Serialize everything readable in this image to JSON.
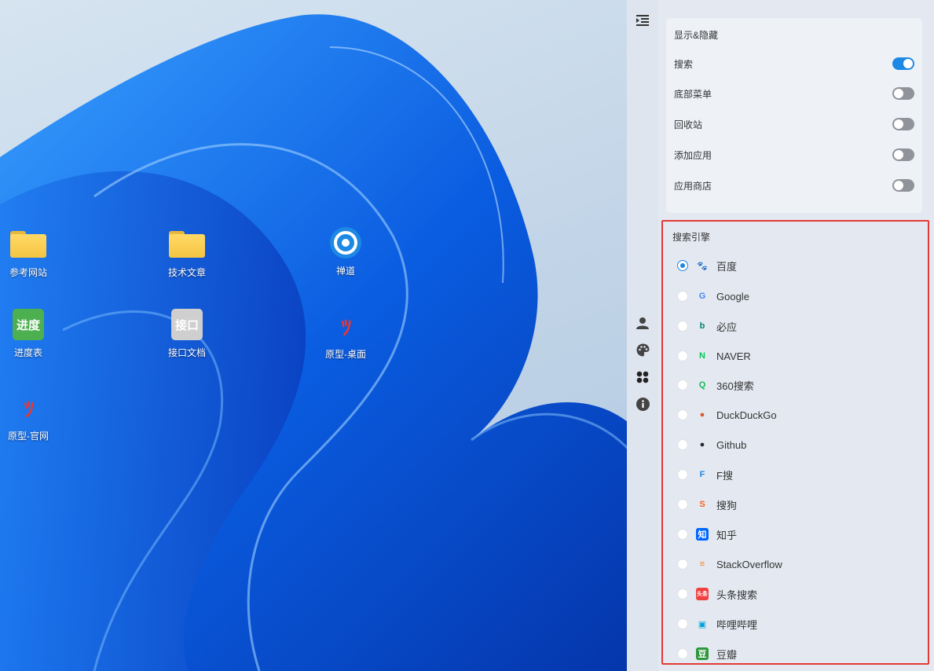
{
  "desktop": {
    "icons": [
      {
        "label": "参考网站",
        "icon": "folder-icon"
      },
      {
        "label": "技术文章",
        "icon": "folder-icon"
      },
      {
        "label": "禅道",
        "icon": "zentao-icon"
      },
      {
        "label": "进度表",
        "icon": "progress-tile-icon",
        "tile_text": "进度"
      },
      {
        "label": "接口文档",
        "icon": "api-tile-icon",
        "tile_text": "接口"
      },
      {
        "label": "原型-桌面",
        "icon": "prototype-icon",
        "tile_text": "ﾂ"
      },
      {
        "label": "原型-官网",
        "icon": "prototype-icon",
        "tile_text": "ﾂ"
      }
    ]
  },
  "rail": {
    "items": [
      {
        "icon": "collapse-menu-icon"
      },
      {
        "icon": "user-icon"
      },
      {
        "icon": "palette-icon"
      },
      {
        "icon": "apps-icon"
      },
      {
        "icon": "info-icon"
      }
    ]
  },
  "panel": {
    "show_hide": {
      "title": "显示&隐藏",
      "toggles": [
        {
          "label": "搜索",
          "on": true
        },
        {
          "label": "底部菜单",
          "on": false
        },
        {
          "label": "回收站",
          "on": false
        },
        {
          "label": "添加应用",
          "on": false
        },
        {
          "label": "应用商店",
          "on": false
        }
      ]
    },
    "engines": {
      "title": "搜索引擎",
      "selected": "百度",
      "items": [
        {
          "name": "百度",
          "icon": "baidu-icon",
          "glyph": "🐾",
          "color": "#2932e1"
        },
        {
          "name": "Google",
          "icon": "google-icon",
          "glyph": "G",
          "color": "#4285f4"
        },
        {
          "name": "必应",
          "icon": "bing-icon",
          "glyph": "b",
          "color": "#008373"
        },
        {
          "name": "NAVER",
          "icon": "naver-icon",
          "glyph": "N",
          "color": "#03c75a"
        },
        {
          "name": "360搜索",
          "icon": "360-search-icon",
          "glyph": "Q",
          "color": "#19b955"
        },
        {
          "name": "DuckDuckGo",
          "icon": "duckduckgo-icon",
          "glyph": "●",
          "color": "#de5833"
        },
        {
          "name": "Github",
          "icon": "github-icon",
          "glyph": "●",
          "color": "#24292e"
        },
        {
          "name": "F搜",
          "icon": "fsou-icon",
          "glyph": "F",
          "color": "#1e88e5"
        },
        {
          "name": "搜狗",
          "icon": "sogou-icon",
          "glyph": "S",
          "color": "#fb6022"
        },
        {
          "name": "知乎",
          "icon": "zhihu-icon",
          "glyph": "知",
          "color": "#0066ff"
        },
        {
          "name": "StackOverflow",
          "icon": "stackoverflow-icon",
          "glyph": "≡",
          "color": "#f48024"
        },
        {
          "name": "头条搜索",
          "icon": "toutiao-icon",
          "glyph": "头条",
          "color": "#f04142"
        },
        {
          "name": "哔哩哔哩",
          "icon": "bilibili-icon",
          "glyph": "▣",
          "color": "#00a1d6"
        },
        {
          "name": "豆瓣",
          "icon": "douban-icon",
          "glyph": "豆",
          "color": "#2e963d"
        }
      ]
    }
  }
}
